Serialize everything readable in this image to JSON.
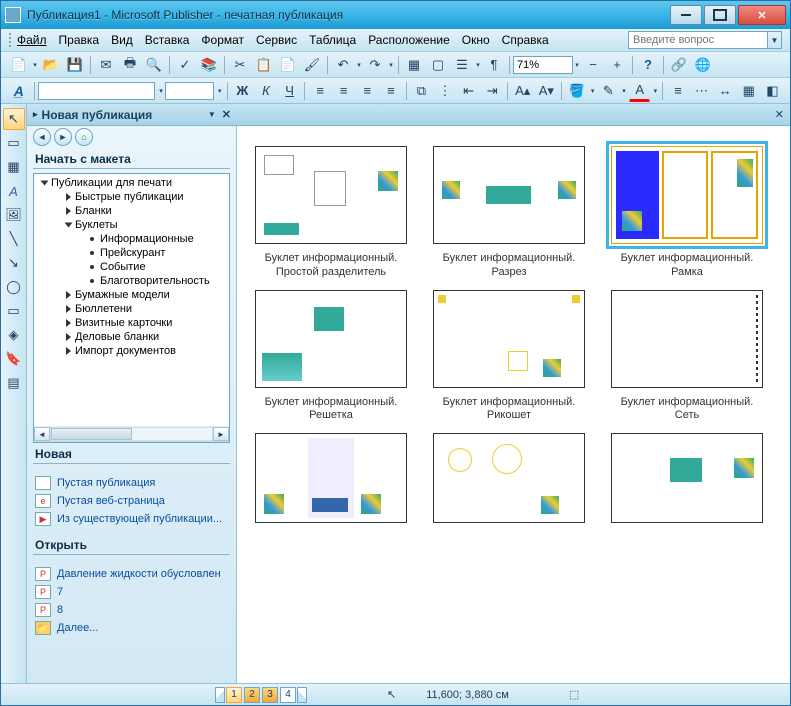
{
  "window": {
    "title": "Публикация1 - Microsoft Publisher - печатная публикация"
  },
  "menu": {
    "items": [
      "Файл",
      "Правка",
      "Вид",
      "Вставка",
      "Формат",
      "Сервис",
      "Таблица",
      "Расположение",
      "Окно",
      "Справка"
    ],
    "help_placeholder": "Введите вопрос"
  },
  "toolbar": {
    "zoom": "71%"
  },
  "taskpane": {
    "title": "Новая публикация",
    "section1": "Начать с макета",
    "tree": {
      "root": "Публикации для печати",
      "items": [
        {
          "label": "Быстрые публикации",
          "level": 2,
          "expandable": true
        },
        {
          "label": "Бланки",
          "level": 2,
          "expandable": true
        },
        {
          "label": "Буклеты",
          "level": 2,
          "expandable": true,
          "open": true
        },
        {
          "label": "Информационные",
          "level": 3
        },
        {
          "label": "Прейскурант",
          "level": 3
        },
        {
          "label": "Событие",
          "level": 3
        },
        {
          "label": "Благотворительность",
          "level": 3
        },
        {
          "label": "Бумажные модели",
          "level": 2,
          "expandable": true
        },
        {
          "label": "Бюллетени",
          "level": 2,
          "expandable": true
        },
        {
          "label": "Визитные карточки",
          "level": 2,
          "expandable": true
        },
        {
          "label": "Деловые бланки",
          "level": 2,
          "expandable": true
        },
        {
          "label": "Импорт документов",
          "level": 2,
          "expandable": true
        }
      ]
    },
    "section2": "Новая",
    "links_new": [
      "Пустая публикация",
      "Пустая веб-страница",
      "Из существующей публикации..."
    ],
    "section3": "Открыть",
    "links_open": [
      "Давление жидкости обусловлен",
      "7",
      "8",
      "Далее..."
    ]
  },
  "gallery": {
    "items": [
      {
        "title": "Буклет информационный. Простой разделитель"
      },
      {
        "title": "Буклет информационный. Разрез"
      },
      {
        "title": "Буклет информационный. Рамка",
        "selected": true
      },
      {
        "title": "Буклет информационный. Решетка"
      },
      {
        "title": "Буклет информационный. Рикошет"
      },
      {
        "title": "Буклет информационный. Сеть"
      }
    ]
  },
  "status": {
    "pages": [
      "1",
      "2",
      "3",
      "4"
    ],
    "active_page": 1,
    "coords": "11,600; 3,880 см"
  }
}
